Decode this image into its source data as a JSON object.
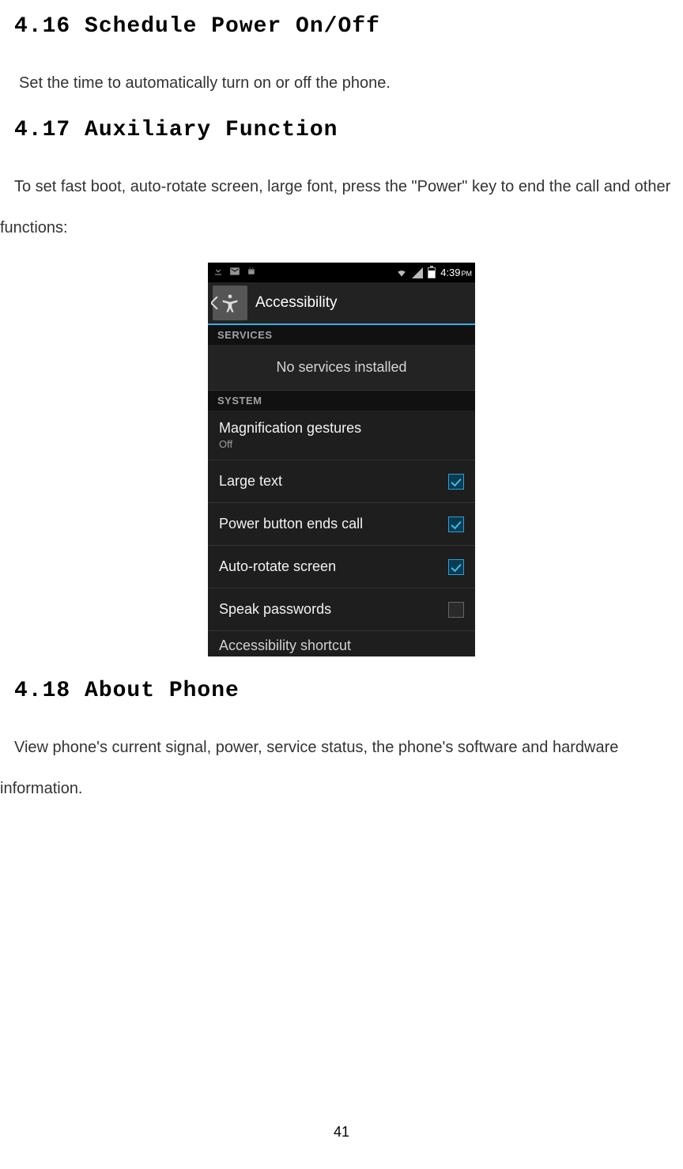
{
  "doc": {
    "h416": "4.16 Schedule Power On/Off",
    "p416": "Set the time to automatically turn on or off the phone.",
    "h417": "4.17 Auxiliary Function",
    "p417": "To set fast boot, auto-rotate screen, large font, press the \"Power\" key to end the call and other functions:",
    "h418": "4.18 About Phone",
    "p418": "View phone's current signal, power, service status, the phone's software and hardware information.",
    "page_number": "41"
  },
  "phone": {
    "status_time": "4:39",
    "status_pm": "PM",
    "actionbar_title": "Accessibility",
    "hdr_services": "SERVICES",
    "no_services": "No services installed",
    "hdr_system": "SYSTEM",
    "rows": {
      "magnification": {
        "label": "Magnification gestures",
        "sub": "Off"
      },
      "large_text": {
        "label": "Large text"
      },
      "power_ends": {
        "label": "Power button ends call"
      },
      "auto_rotate": {
        "label": "Auto-rotate screen"
      },
      "speak_pw": {
        "label": "Speak passwords"
      },
      "shortcut": {
        "label": "Accessibility shortcut"
      }
    }
  }
}
